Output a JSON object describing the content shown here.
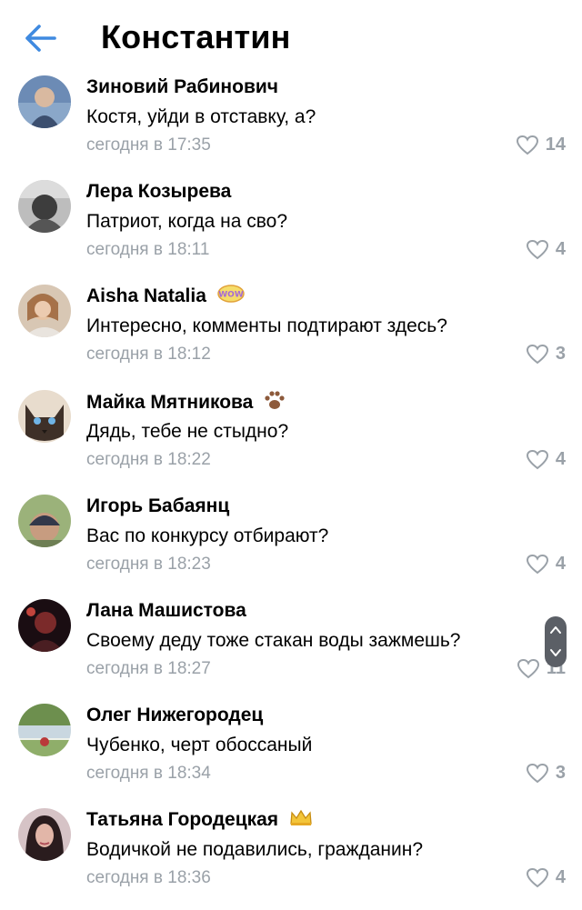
{
  "header": {
    "back_icon": "arrow-left-icon",
    "title": "Константин",
    "accent_color": "#3f8ae0"
  },
  "comments": [
    {
      "author": "Зиновий Рабинович",
      "text": "Костя, уйди в отставку, а?",
      "time": "сегодня в 17:35",
      "likes": "14",
      "badge": ""
    },
    {
      "author": "Лера Козырева",
      "text": "Патриот, когда на сво?",
      "time": "сегодня в 18:11",
      "likes": "4",
      "badge": ""
    },
    {
      "author": "Aisha Natalia",
      "text": "Интересно, комменты подтирают здесь?",
      "time": "сегодня в 18:12",
      "likes": "3",
      "badge": "wow-sticker-icon"
    },
    {
      "author": "Майка Мятникова",
      "text": "Дядь, тебе не стыдно?",
      "time": "сегодня в 18:22",
      "likes": "4",
      "badge": "paw-icon"
    },
    {
      "author": "Игорь Бабаянц",
      "text": "Вас по конкурсу отбирают?",
      "time": "сегодня в 18:23",
      "likes": "4",
      "badge": ""
    },
    {
      "author": "Лана Машистова",
      "text": "Своему деду тоже стакан воды зажмешь?",
      "time": "сегодня в 18:27",
      "likes": "11",
      "badge": ""
    },
    {
      "author": "Олег Нижегородец",
      "text": "Чубенко, черт обоссаный",
      "time": "сегодня в 18:34",
      "likes": "3",
      "badge": ""
    },
    {
      "author": "Татьяна Городецкая",
      "text": "Водичкой не подавились, гражданин?",
      "time": "сегодня в 18:36",
      "likes": "4",
      "badge": "crown-icon"
    }
  ],
  "scroll_buttons": {
    "up_icon": "chevron-up-icon",
    "down_icon": "chevron-down-icon"
  }
}
